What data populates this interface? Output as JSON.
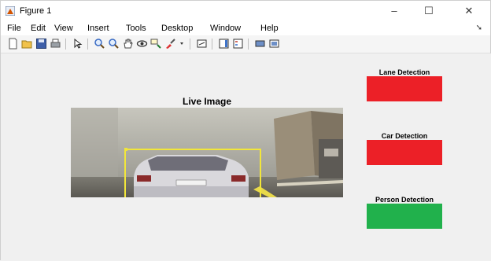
{
  "window": {
    "title": "Figure 1",
    "controls": {
      "minimize": "–",
      "maximize": "☐",
      "close": "✕"
    }
  },
  "menu": {
    "items": [
      "File",
      "Edit",
      "View",
      "Insert",
      "Tools",
      "Desktop",
      "Window",
      "Help"
    ],
    "overflow_arrow": "➘"
  },
  "toolbar": {
    "icons": [
      "new-figure-icon",
      "open-file-icon",
      "save-icon",
      "print-icon",
      "edit-plot-arrow-icon",
      "zoom-in-icon",
      "zoom-out-icon",
      "pan-hand-icon",
      "rotate-3d-icon",
      "data-cursor-icon",
      "brush-icon",
      "link-plot-icon",
      "insert-colorbar-icon",
      "insert-legend-icon",
      "hide-plot-tools-icon",
      "show-plot-tools-icon"
    ]
  },
  "live_image": {
    "title": "Live Image",
    "detection_box_color": "#f2e63a"
  },
  "panels": [
    {
      "title": "Lane Detection",
      "color": "#ec2027"
    },
    {
      "title": "Car Detection",
      "color": "#ec2027"
    },
    {
      "title": "Person Detection",
      "color": "#21b14c"
    }
  ]
}
